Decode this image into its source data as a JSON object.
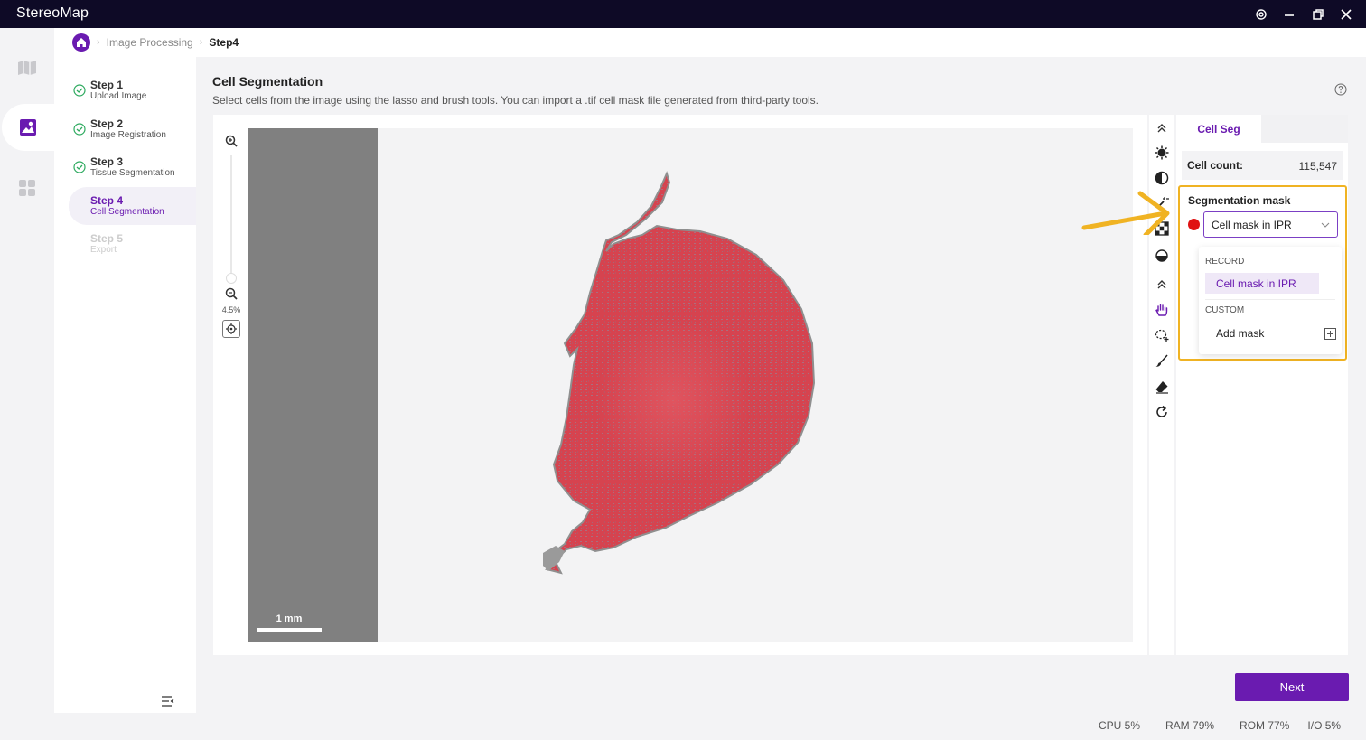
{
  "app": {
    "title": "StereoMap"
  },
  "breadcrumb": {
    "parent": "Image Processing",
    "current": "Step4"
  },
  "steps": [
    {
      "title": "Step 1",
      "sub": "Upload Image"
    },
    {
      "title": "Step 2",
      "sub": "Image Registration"
    },
    {
      "title": "Step 3",
      "sub": "Tissue Segmentation"
    },
    {
      "title": "Step 4",
      "sub": "Cell Segmentation"
    },
    {
      "title": "Step 5",
      "sub": "Export"
    }
  ],
  "main": {
    "title": "Cell Segmentation",
    "description": "Select cells from the image using the lasso and brush tools. You can import a .tif cell mask file generated from third-party tools."
  },
  "viewer": {
    "zoom": "4.5%",
    "scalebar": "1 mm"
  },
  "panel": {
    "tab": "Cell Seg",
    "cell_count_label": "Cell count:",
    "cell_count_value": "115,547",
    "seg_title": "Segmentation mask",
    "selected_mask": "Cell mask in IPR",
    "mask_color": "#e01313",
    "dropdown": {
      "record_group": "RECORD",
      "record_item": "Cell mask in IPR",
      "custom_group": "CUSTOM",
      "add_item": "Add mask"
    }
  },
  "footer": {
    "next_label": "Next",
    "cpu": "CPU  5%",
    "ram": "RAM  79%",
    "rom": "ROM  77%",
    "io": "I/O  5%"
  },
  "colors": {
    "accent": "#6a1bb0",
    "titlebar": "#0e0a26",
    "highlight": "#f0b323",
    "tissue": "#d6434f"
  }
}
